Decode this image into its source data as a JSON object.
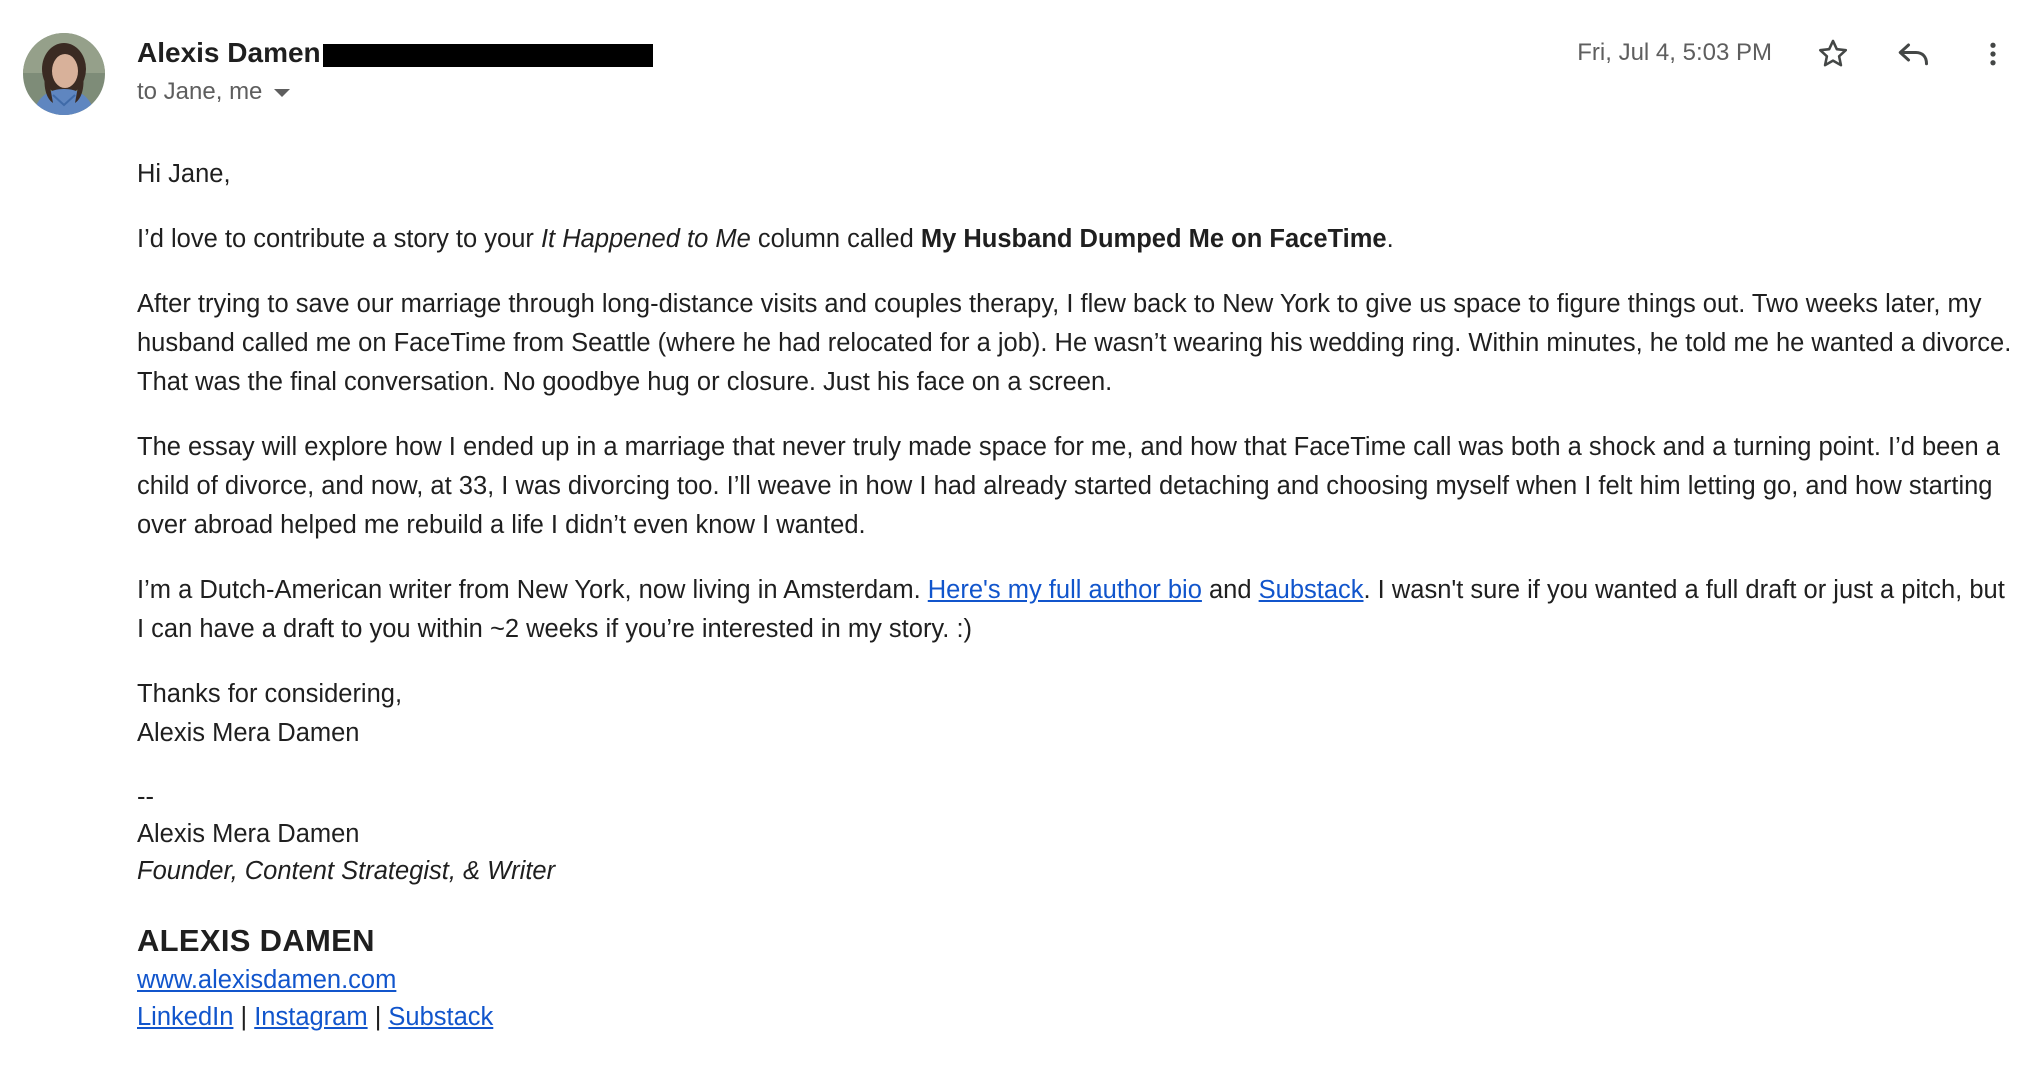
{
  "header": {
    "sender_name": "Alexis Damen",
    "recipients": "to Jane, me",
    "timestamp": "Fri, Jul 4, 5:03 PM",
    "icons": {
      "avatar": "sender-avatar-photo",
      "recipients_toggle": "chevron-down-icon",
      "star": "star-icon",
      "reply": "reply-icon",
      "more": "more-vert-icon"
    }
  },
  "message": {
    "greeting": "Hi Jane,",
    "p1": {
      "before": "I’d love to contribute a story to your ",
      "column": "It Happened to Me",
      "middle": " column called ",
      "title": "My Husband Dumped Me on FaceTime",
      "after": "."
    },
    "p2": "After trying to save our marriage through long-distance visits and couples therapy, I flew back to New York to give us space to figure things out. Two weeks later, my husband called me on FaceTime from Seattle (where he had relocated for a job). He wasn’t wearing his wedding ring. Within minutes, he told me he wanted a divorce. That was the final conversation. No goodbye hug or closure. Just his face on a screen.",
    "p3": "The essay will explore how I ended up in a marriage that never truly made space for me, and how that FaceTime call was both a shock and a turning point. I’d been a child of divorce, and now, at 33, I was divorcing too. I’ll weave in how I had already started detaching and choosing myself when I felt him letting go, and how starting over abroad helped me rebuild a life I didn’t even know I wanted.",
    "p4": {
      "before": "I’m a Dutch-American writer from New York, now living in Amsterdam. ",
      "bio_link": "Here's my full author bio",
      "and": " and ",
      "substack_link": "Substack",
      "after": ". I wasn't sure if you wanted a full draft or just a pitch, but I can have a draft to you within ~2 weeks if you’re interested in my story. :)"
    },
    "closing": "Thanks for considering,",
    "closing_name": "Alexis Mera Damen"
  },
  "signature": {
    "dashes": "--",
    "name": "Alexis Mera Damen",
    "role": "Founder, Content Strategist, & Writer",
    "brand": "ALEXIS DAMEN",
    "website": "www.alexisdamen.com",
    "links": [
      "LinkedIn",
      "Instagram",
      "Substack"
    ],
    "separator": " | "
  },
  "colors": {
    "text": "#1f1f1f",
    "meta": "#5e5e5e",
    "link": "#1155cc"
  }
}
